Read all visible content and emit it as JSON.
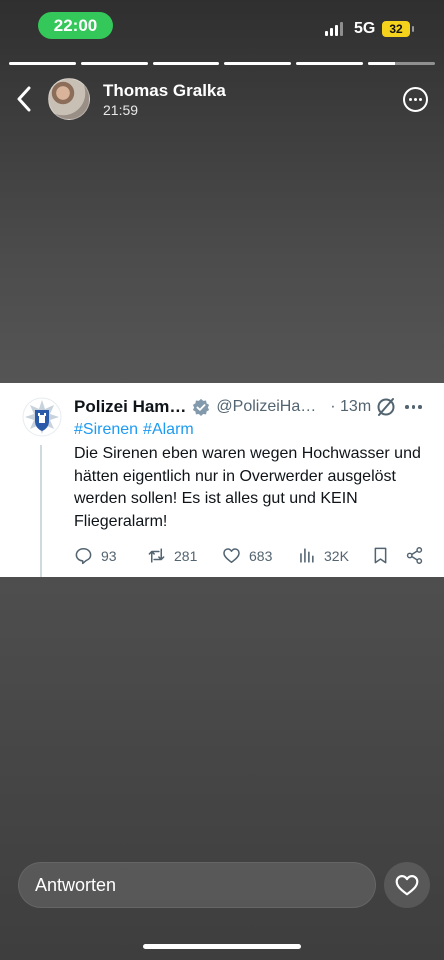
{
  "status_bar": {
    "time": "22:00",
    "network": "5G",
    "battery": "32"
  },
  "story": {
    "segments": [
      1,
      1,
      1,
      1,
      1,
      0.4
    ],
    "user_name": "Thomas Gralka",
    "post_time": "21:59",
    "icons": {
      "back": "chevron-left-icon",
      "more": "more-circle-icon"
    }
  },
  "tweet": {
    "author_name": "Polizei Ham…",
    "handle": "@PolizeiHa…",
    "dot_age": "· 13m",
    "hashtags": [
      "#Sirenen",
      "#Alarm"
    ],
    "body": "Die Sirenen eben waren wegen Hochwasser und hätten eigentlich nur in Overwerder ausgelöst werden sollen! Es ist alles gut und KEIN Fliegeralarm!",
    "stats": {
      "replies": "93",
      "retweets": "281",
      "likes": "683",
      "views": "32K"
    },
    "colors": {
      "link": "#1d9bf0",
      "verified": "#829aab",
      "muted": "#536471"
    }
  },
  "reply": {
    "placeholder": "Antworten"
  },
  "colors": {
    "time_pill": "#34c759",
    "battery": "#f5d31c"
  }
}
